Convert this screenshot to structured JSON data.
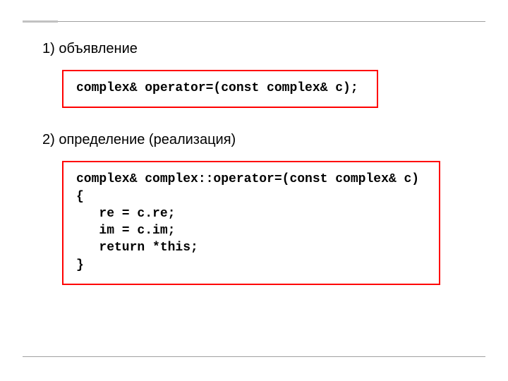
{
  "sections": {
    "declaration": {
      "label": "1) объявление",
      "code": "complex& operator=(const complex& c);"
    },
    "definition": {
      "label": "2) определение (реализация)",
      "code": "complex& complex::operator=(const complex& c)\n{\n   re = c.re;\n   im = c.im;\n   return *this;\n}"
    }
  }
}
